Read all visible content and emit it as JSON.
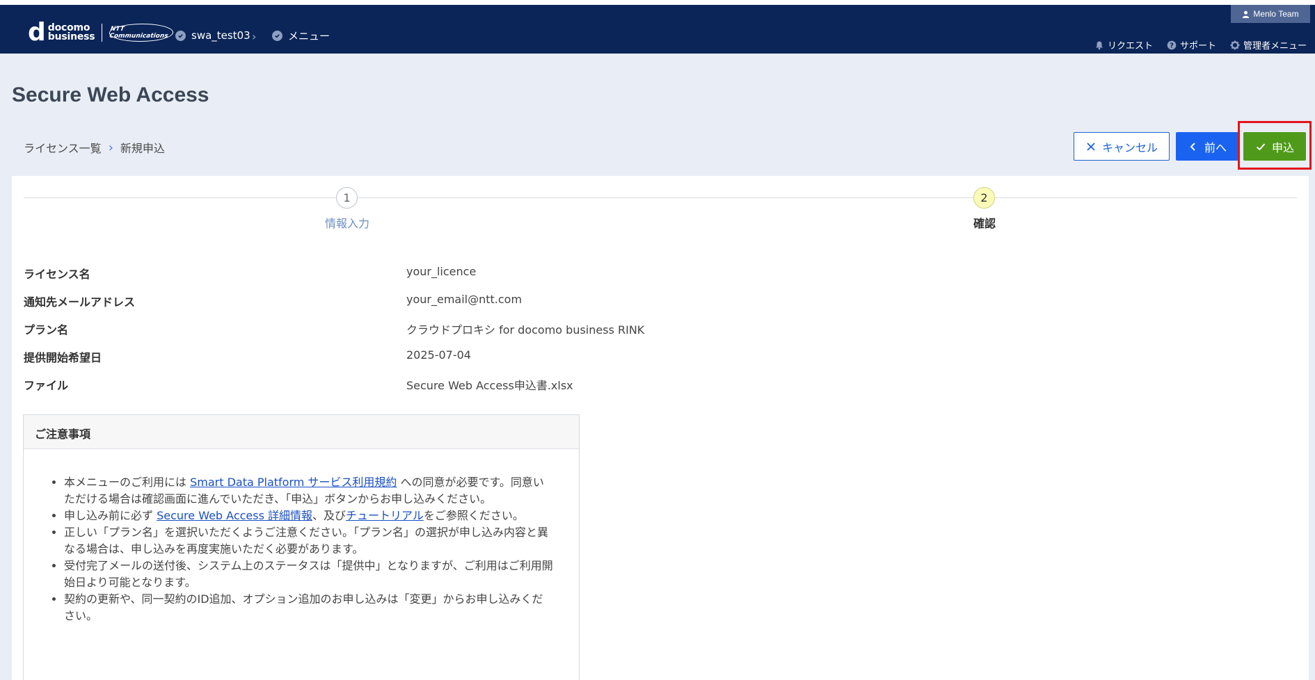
{
  "header": {
    "logo_mark": "d",
    "logo_line1": "docomo",
    "logo_line2": "business",
    "ntt_logo": "NTT Communications",
    "breadcrumb": [
      "swa_test03",
      "メニュー"
    ],
    "user": "Menlo Team",
    "links": [
      "リクエスト",
      "サポート",
      "管理者メニュー"
    ]
  },
  "page": {
    "title": "Secure Web Access",
    "breadcrumb": [
      "ライセンス一覧",
      "新規申込"
    ]
  },
  "buttons": {
    "cancel": "キャンセル",
    "prev": "前へ",
    "apply": "申込"
  },
  "steps": [
    {
      "number": "1",
      "label": "情報入力"
    },
    {
      "number": "2",
      "label": "確認"
    }
  ],
  "info": [
    {
      "label": "ライセンス名",
      "value": "your_licence"
    },
    {
      "label": "通知先メールアドレス",
      "value": "your_email@ntt.com"
    },
    {
      "label": "プラン名",
      "value": "クラウドプロキシ for docomo business RINK"
    },
    {
      "label": "提供開始希望日",
      "value": "2025-07-04"
    },
    {
      "label": "ファイル",
      "value": "Secure Web Access申込書.xlsx"
    }
  ],
  "notice": {
    "title": "ご注意事項",
    "item1_pre": "本メニューのご利用には ",
    "item1_link": "Smart Data Platform サービス利用規約",
    "item1_post": " への同意が必要です。同意いただける場合は確認画面に進んでいただき、「申込」ボタンからお申し込みください。",
    "item2_pre": "申し込み前に必ず ",
    "item2_link1": "Secure Web Access 詳細情報",
    "item2_mid": "、及び",
    "item2_link2": "チュートリアル",
    "item2_post": "をご参照ください。",
    "item3": "正しい「プラン名」を選択いただくようご注意ください。「プラン名」の選択が申し込み内容と異なる場合は、申し込みを再度実施いただく必要があります。",
    "item4": "受付完了メールの送付後、システム上のステータスは「提供中」となりますが、ご利用はご利用開始日より可能となります。",
    "item5": "契約の更新や、同一契約のID追加、オプション追加のお申し込みは「変更」からお申し込みください。"
  },
  "colors": {
    "header_bg": "#0b2558",
    "primary": "#1a63f0",
    "apply": "#4f9a1a",
    "highlight": "#e3141d"
  }
}
